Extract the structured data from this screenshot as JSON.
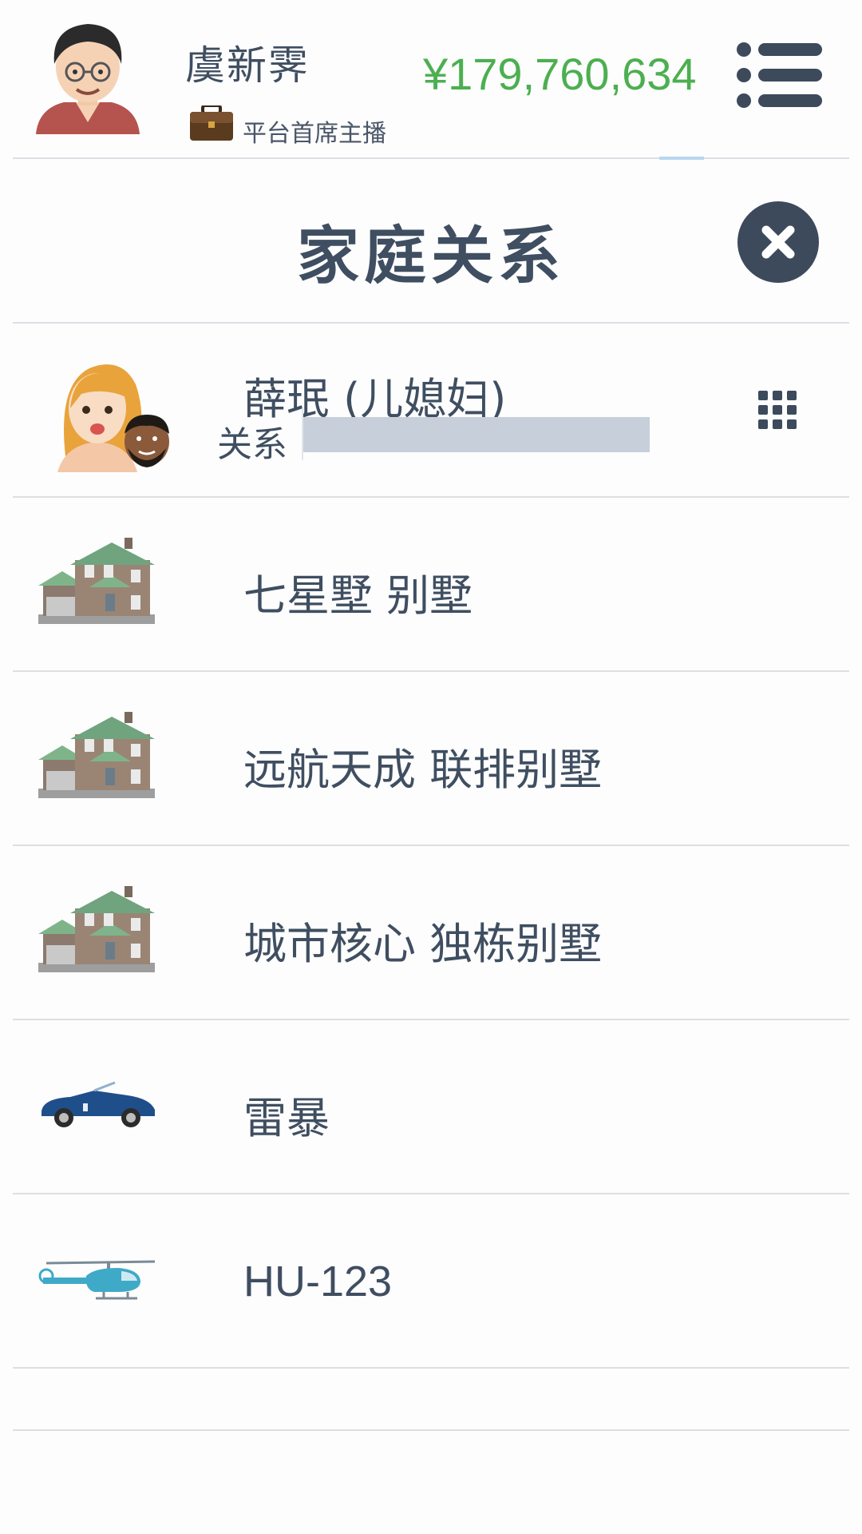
{
  "header": {
    "player_name": "虞新霁",
    "player_title": "平台首席主播",
    "money": "¥179,760,634",
    "avatar_icon": "man-with-glasses-avatar",
    "title_icon": "briefcase-icon",
    "menu_icon": "list-menu-icon",
    "money_color": "#4caf50"
  },
  "modal": {
    "title": "家庭关系",
    "close_icon": "close-icon"
  },
  "family": {
    "member_name": "薛珉 (儿媳妇)",
    "relation_label": "关系",
    "relation_level": 0,
    "member_icon": "woman-and-man-avatar",
    "options_icon": "grid-dots-icon"
  },
  "assets": [
    {
      "name": "七星墅 别墅",
      "icon": "villa-icon"
    },
    {
      "name": "远航天成 联排别墅",
      "icon": "villa-icon"
    },
    {
      "name": "城市核心 独栋别墅",
      "icon": "villa-icon"
    },
    {
      "name": "雷暴",
      "icon": "convertible-car-icon"
    },
    {
      "name": "HU-123",
      "icon": "helicopter-icon"
    }
  ]
}
